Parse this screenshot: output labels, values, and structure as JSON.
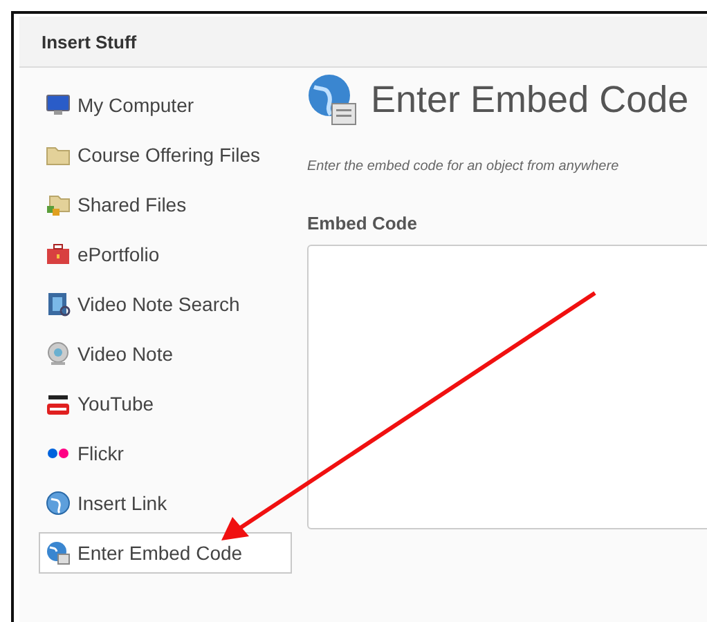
{
  "dialog": {
    "title": "Insert Stuff"
  },
  "sidebar": {
    "items": [
      {
        "kind": "computer",
        "label": "My Computer",
        "selected": false
      },
      {
        "kind": "folder",
        "label": "Course Offering Files",
        "selected": false
      },
      {
        "kind": "shared",
        "label": "Shared Files",
        "selected": false
      },
      {
        "kind": "portfolio",
        "label": "ePortfolio",
        "selected": false
      },
      {
        "kind": "videosearch",
        "label": "Video Note Search",
        "selected": false
      },
      {
        "kind": "webcam",
        "label": "Video Note",
        "selected": false
      },
      {
        "kind": "youtube",
        "label": "YouTube",
        "selected": false
      },
      {
        "kind": "flickr",
        "label": "Flickr",
        "selected": false
      },
      {
        "kind": "link",
        "label": "Insert Link",
        "selected": false
      },
      {
        "kind": "embed",
        "label": "Enter Embed Code",
        "selected": true
      }
    ]
  },
  "main": {
    "title": "Enter Embed Code",
    "description": "Enter the embed code for an object from anywhere",
    "field_label": "Embed Code"
  },
  "annotation": {
    "kind": "arrow"
  }
}
